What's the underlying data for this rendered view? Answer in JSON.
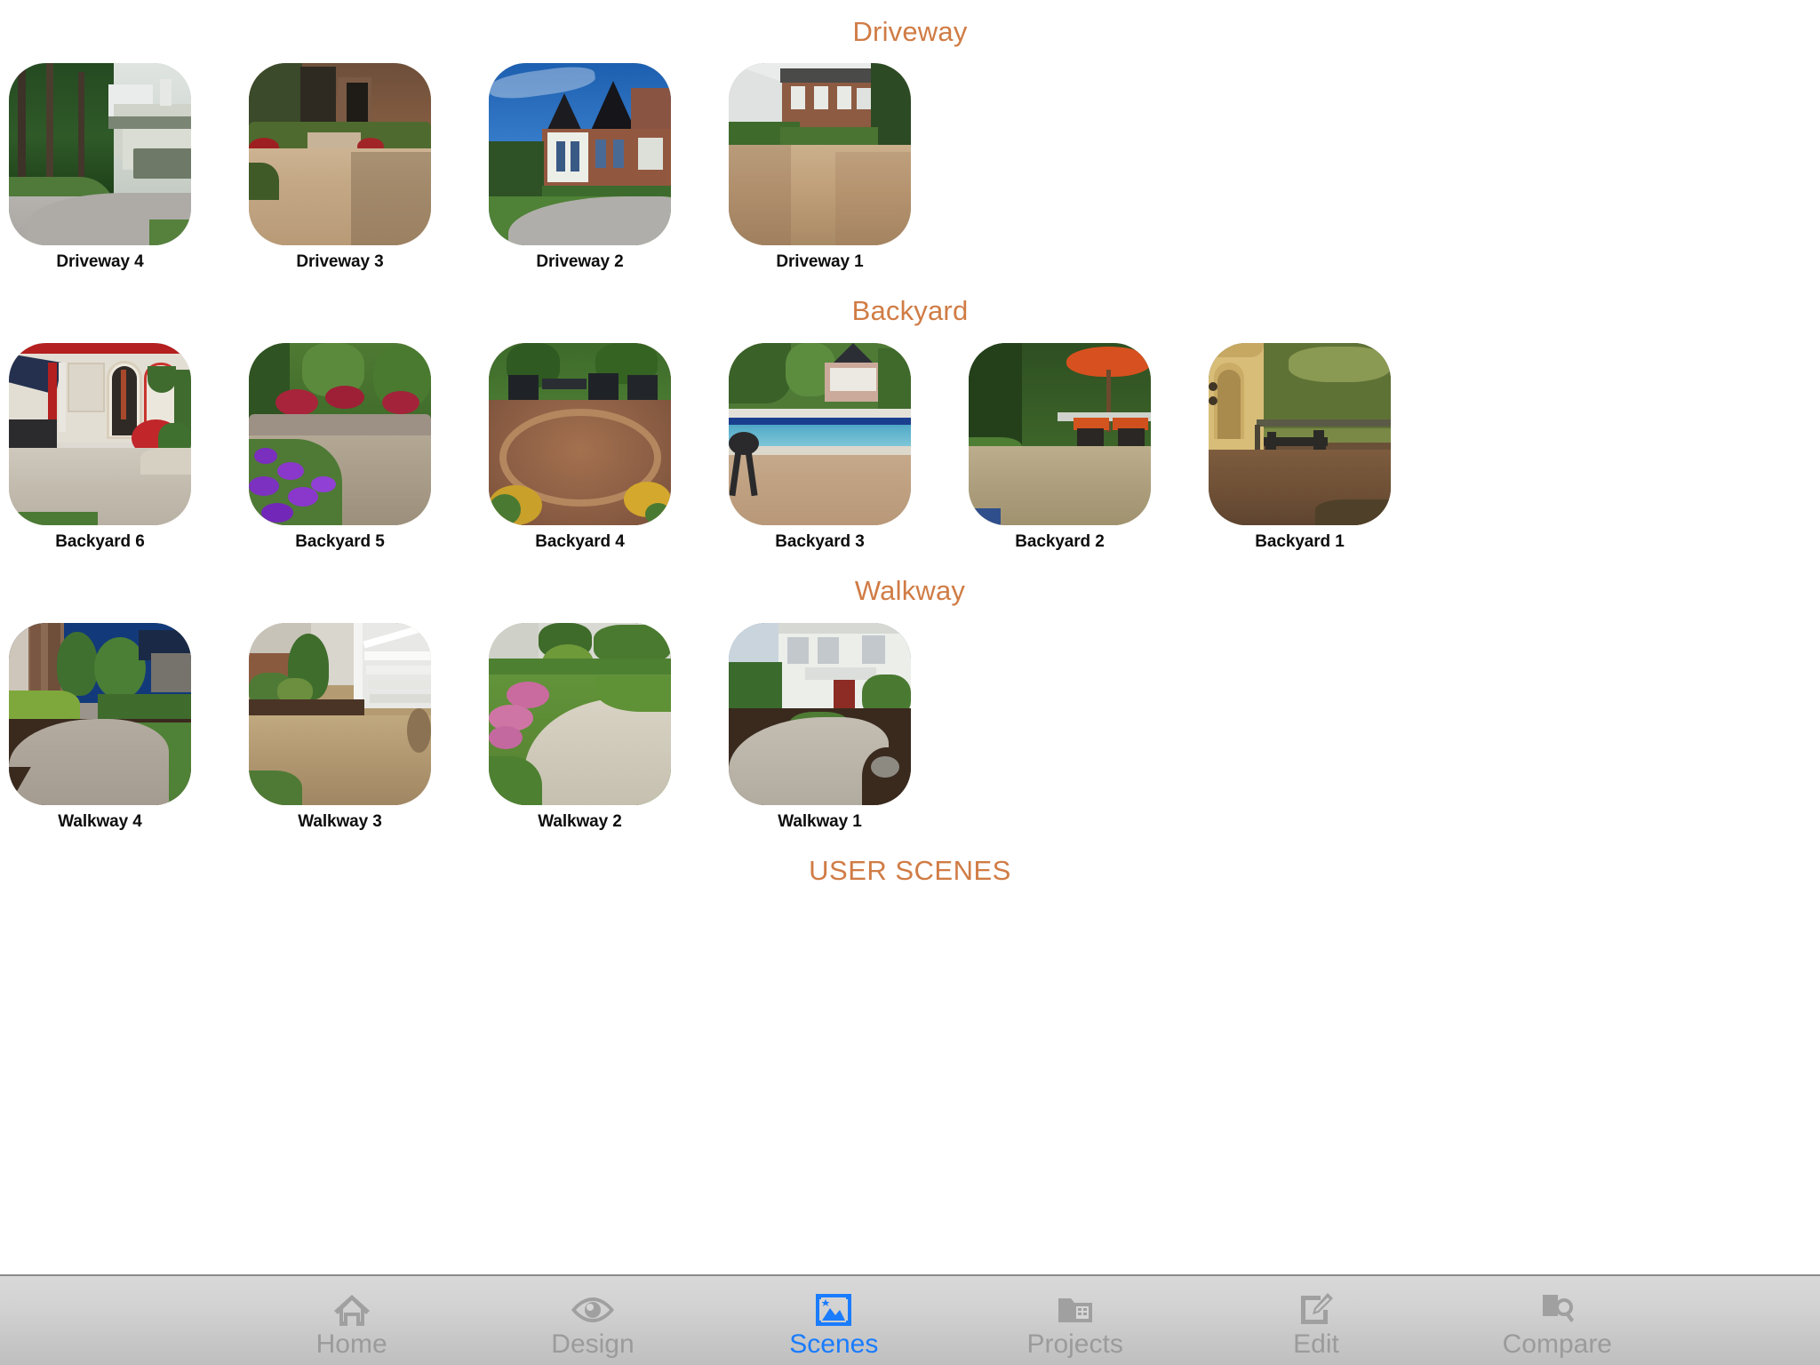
{
  "app": {
    "accent_header_color": "#d07c45",
    "active_tab_color": "#1a7cff",
    "inactive_tab_color": "#9b9b9b"
  },
  "sections": [
    {
      "id": "driveway",
      "title": "Driveway",
      "scenes": [
        {
          "label": "Driveway 4",
          "desc": "gray paver driveway with craftsman house among tall evergreens"
        },
        {
          "label": "Driveway 3",
          "desc": "tan brick paver driveway leading to brick home with hedges"
        },
        {
          "label": "Driveway 2",
          "desc": "curved gray driveway in front of large brick home, blue sky"
        },
        {
          "label": "Driveway 1",
          "desc": "multi-tone paver driveway beside brick colonial home"
        }
      ]
    },
    {
      "id": "backyard",
      "title": "Backyard",
      "scenes": [
        {
          "label": "Backyard 6",
          "desc": "stone patio with arched doorway, red flowers and umbrella"
        },
        {
          "label": "Backyard 5",
          "desc": "garden patio with purple petunias and retaining wall"
        },
        {
          "label": "Backyard 4",
          "desc": "circular paver patio with dining table and chairs"
        },
        {
          "label": "Backyard 3",
          "desc": "poolside paver deck with house in background"
        },
        {
          "label": "Backyard 2",
          "desc": "patio with orange umbrella and bistro set under trees"
        },
        {
          "label": "Backyard 1",
          "desc": "courtyard patio with stucco wall and iron bench"
        }
      ]
    },
    {
      "id": "walkway",
      "title": "Walkway",
      "scenes": [
        {
          "label": "Walkway 4",
          "desc": "curving paver walkway beside house with shrubs"
        },
        {
          "label": "Walkway 3",
          "desc": "paver walkway to white porch steps with mulch beds"
        },
        {
          "label": "Walkway 2",
          "desc": "wide curved walkway across green lawn with pink flowers"
        },
        {
          "label": "Walkway 1",
          "desc": "walkway to front door of white house with red door"
        }
      ]
    },
    {
      "id": "user-scenes",
      "title": "USER SCENES",
      "scenes": []
    }
  ],
  "tabbar": {
    "items": [
      {
        "id": "home",
        "label": "Home",
        "icon": "house-icon",
        "active": false
      },
      {
        "id": "design",
        "label": "Design",
        "icon": "eye-icon",
        "active": false
      },
      {
        "id": "scenes",
        "label": "Scenes",
        "icon": "photo-icon",
        "active": true
      },
      {
        "id": "projects",
        "label": "Projects",
        "icon": "folder-list-icon",
        "active": false
      },
      {
        "id": "edit",
        "label": "Edit",
        "icon": "pencil-paper-icon",
        "active": false
      },
      {
        "id": "compare",
        "label": "Compare",
        "icon": "document-search-icon",
        "active": false
      }
    ]
  }
}
